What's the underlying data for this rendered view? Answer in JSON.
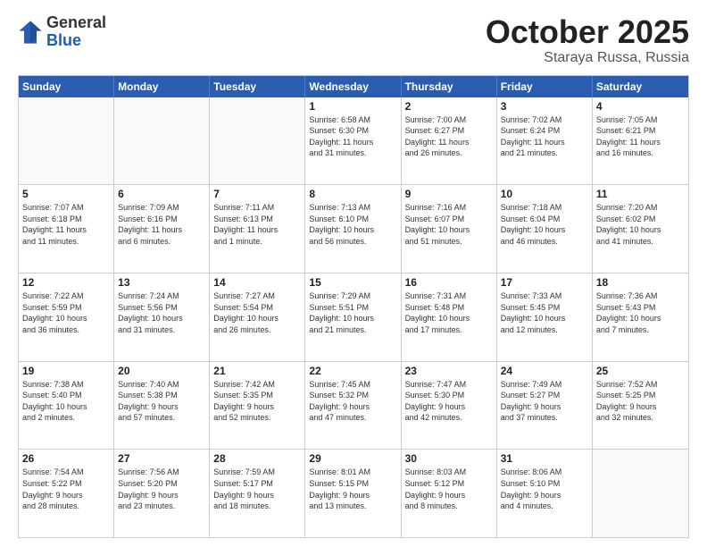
{
  "header": {
    "logo": {
      "line1": "General",
      "line2": "Blue"
    },
    "month": "October 2025",
    "location": "Staraya Russa, Russia"
  },
  "days_of_week": [
    "Sunday",
    "Monday",
    "Tuesday",
    "Wednesday",
    "Thursday",
    "Friday",
    "Saturday"
  ],
  "weeks": [
    [
      {
        "day": "",
        "info": ""
      },
      {
        "day": "",
        "info": ""
      },
      {
        "day": "",
        "info": ""
      },
      {
        "day": "1",
        "info": "Sunrise: 6:58 AM\nSunset: 6:30 PM\nDaylight: 11 hours\nand 31 minutes."
      },
      {
        "day": "2",
        "info": "Sunrise: 7:00 AM\nSunset: 6:27 PM\nDaylight: 11 hours\nand 26 minutes."
      },
      {
        "day": "3",
        "info": "Sunrise: 7:02 AM\nSunset: 6:24 PM\nDaylight: 11 hours\nand 21 minutes."
      },
      {
        "day": "4",
        "info": "Sunrise: 7:05 AM\nSunset: 6:21 PM\nDaylight: 11 hours\nand 16 minutes."
      }
    ],
    [
      {
        "day": "5",
        "info": "Sunrise: 7:07 AM\nSunset: 6:18 PM\nDaylight: 11 hours\nand 11 minutes."
      },
      {
        "day": "6",
        "info": "Sunrise: 7:09 AM\nSunset: 6:16 PM\nDaylight: 11 hours\nand 6 minutes."
      },
      {
        "day": "7",
        "info": "Sunrise: 7:11 AM\nSunset: 6:13 PM\nDaylight: 11 hours\nand 1 minute."
      },
      {
        "day": "8",
        "info": "Sunrise: 7:13 AM\nSunset: 6:10 PM\nDaylight: 10 hours\nand 56 minutes."
      },
      {
        "day": "9",
        "info": "Sunrise: 7:16 AM\nSunset: 6:07 PM\nDaylight: 10 hours\nand 51 minutes."
      },
      {
        "day": "10",
        "info": "Sunrise: 7:18 AM\nSunset: 6:04 PM\nDaylight: 10 hours\nand 46 minutes."
      },
      {
        "day": "11",
        "info": "Sunrise: 7:20 AM\nSunset: 6:02 PM\nDaylight: 10 hours\nand 41 minutes."
      }
    ],
    [
      {
        "day": "12",
        "info": "Sunrise: 7:22 AM\nSunset: 5:59 PM\nDaylight: 10 hours\nand 36 minutes."
      },
      {
        "day": "13",
        "info": "Sunrise: 7:24 AM\nSunset: 5:56 PM\nDaylight: 10 hours\nand 31 minutes."
      },
      {
        "day": "14",
        "info": "Sunrise: 7:27 AM\nSunset: 5:54 PM\nDaylight: 10 hours\nand 26 minutes."
      },
      {
        "day": "15",
        "info": "Sunrise: 7:29 AM\nSunset: 5:51 PM\nDaylight: 10 hours\nand 21 minutes."
      },
      {
        "day": "16",
        "info": "Sunrise: 7:31 AM\nSunset: 5:48 PM\nDaylight: 10 hours\nand 17 minutes."
      },
      {
        "day": "17",
        "info": "Sunrise: 7:33 AM\nSunset: 5:45 PM\nDaylight: 10 hours\nand 12 minutes."
      },
      {
        "day": "18",
        "info": "Sunrise: 7:36 AM\nSunset: 5:43 PM\nDaylight: 10 hours\nand 7 minutes."
      }
    ],
    [
      {
        "day": "19",
        "info": "Sunrise: 7:38 AM\nSunset: 5:40 PM\nDaylight: 10 hours\nand 2 minutes."
      },
      {
        "day": "20",
        "info": "Sunrise: 7:40 AM\nSunset: 5:38 PM\nDaylight: 9 hours\nand 57 minutes."
      },
      {
        "day": "21",
        "info": "Sunrise: 7:42 AM\nSunset: 5:35 PM\nDaylight: 9 hours\nand 52 minutes."
      },
      {
        "day": "22",
        "info": "Sunrise: 7:45 AM\nSunset: 5:32 PM\nDaylight: 9 hours\nand 47 minutes."
      },
      {
        "day": "23",
        "info": "Sunrise: 7:47 AM\nSunset: 5:30 PM\nDaylight: 9 hours\nand 42 minutes."
      },
      {
        "day": "24",
        "info": "Sunrise: 7:49 AM\nSunset: 5:27 PM\nDaylight: 9 hours\nand 37 minutes."
      },
      {
        "day": "25",
        "info": "Sunrise: 7:52 AM\nSunset: 5:25 PM\nDaylight: 9 hours\nand 32 minutes."
      }
    ],
    [
      {
        "day": "26",
        "info": "Sunrise: 7:54 AM\nSunset: 5:22 PM\nDaylight: 9 hours\nand 28 minutes."
      },
      {
        "day": "27",
        "info": "Sunrise: 7:56 AM\nSunset: 5:20 PM\nDaylight: 9 hours\nand 23 minutes."
      },
      {
        "day": "28",
        "info": "Sunrise: 7:59 AM\nSunset: 5:17 PM\nDaylight: 9 hours\nand 18 minutes."
      },
      {
        "day": "29",
        "info": "Sunrise: 8:01 AM\nSunset: 5:15 PM\nDaylight: 9 hours\nand 13 minutes."
      },
      {
        "day": "30",
        "info": "Sunrise: 8:03 AM\nSunset: 5:12 PM\nDaylight: 9 hours\nand 8 minutes."
      },
      {
        "day": "31",
        "info": "Sunrise: 8:06 AM\nSunset: 5:10 PM\nDaylight: 9 hours\nand 4 minutes."
      },
      {
        "day": "",
        "info": ""
      }
    ]
  ]
}
